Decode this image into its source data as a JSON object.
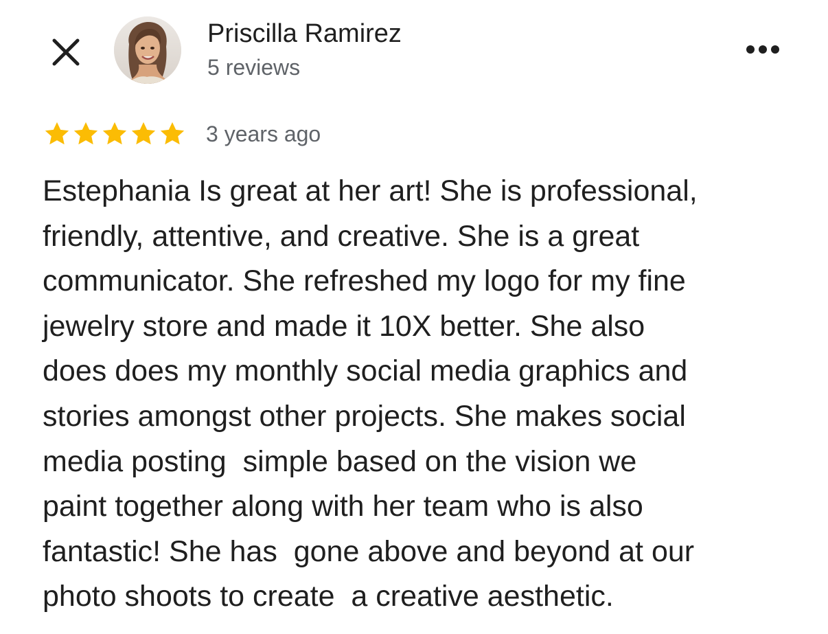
{
  "header": {
    "close_icon": "close-icon",
    "reviewer_name": "Priscilla Ramirez",
    "review_count": "5 reviews",
    "more_icon": "more-horizontal-icon"
  },
  "review": {
    "rating": 5,
    "rating_max": 5,
    "star_color": "#fbbc04",
    "date": "3 years ago",
    "text_lines": [
      "Estephania Is great at her art! She is professional,",
      "friendly, attentive, and creative. She is a great",
      "communicator. She refreshed my logo for my fine",
      "jewelry store and made it 10X better. She also",
      "does does my monthly social media graphics and",
      "stories amongst other projects. She makes social",
      "media posting  simple based on the vision we",
      "paint together along with her team who is also",
      "fantastic! She has  gone above and beyond at our",
      "photo shoots to create  a creative aesthetic."
    ]
  }
}
